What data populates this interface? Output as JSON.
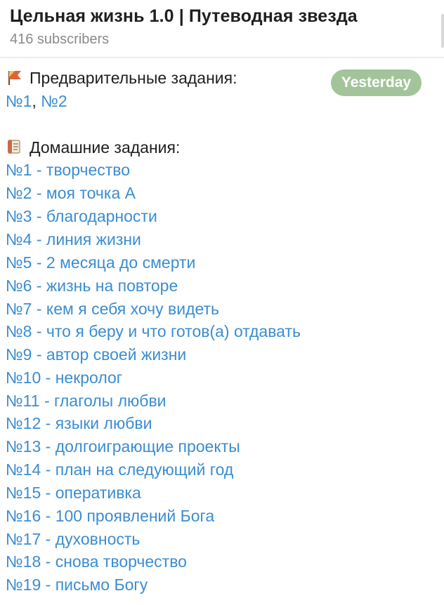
{
  "header": {
    "title": "Цельная жизнь 1.0 | Путеводная звезда",
    "subscribers": "416 subscribers"
  },
  "message": {
    "date_badge": "Yesterday",
    "pre_tasks": {
      "icon": "flag-icon",
      "heading": "Предварительные задания:",
      "links": [
        "№1",
        "№2"
      ],
      "separator": ", "
    },
    "homework": {
      "icon": "scroll-icon",
      "heading": "Домашние задания:",
      "items": [
        "№1 - творчество",
        "№2 - моя точка А",
        "№3 - благодарности",
        "№4 - линия жизни",
        "№5 - 2 месяца до смерти",
        "№6 - жизнь на повторе",
        "№7 - кем я себя хочу видеть",
        "№8 - что я беру и что готов(а) отдавать",
        "№9 - автор своей жизни",
        "№10 - некролог",
        "№11 - глаголы любви",
        "№12 - языки любви",
        "№13 - долгоиграющие проекты",
        "№14 - план на следующий год",
        "№15 - оперативка",
        "№16 - 100 проявлений Бога",
        "№17 - духовность",
        "№18 - снова творчество",
        "№19 - письмо Богу"
      ]
    }
  },
  "colors": {
    "link": "#3b8dd1",
    "badge": "#a3c49a",
    "text": "#1f1f1f",
    "muted": "#8a8a8a"
  }
}
